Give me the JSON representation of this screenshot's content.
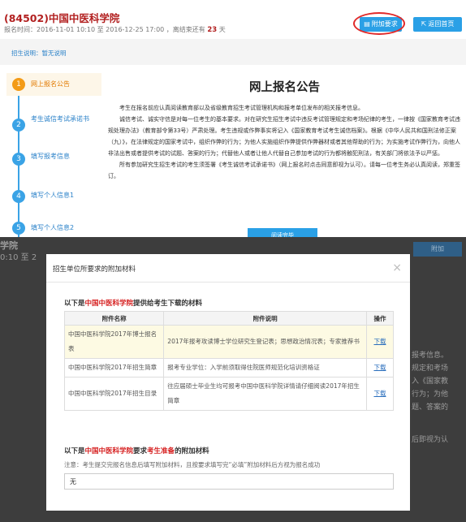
{
  "header": {
    "code": "(84502)",
    "school": "中国中医科学院",
    "meta_prefix": "报名时间：2016-11-01 10:10 至 2016-12-25 17:00 ，离结束还有 ",
    "days": "23",
    "meta_suffix": " 天",
    "btn_requirements": "附加要求",
    "btn_home": "返回首页"
  },
  "subbar": {
    "note": "招生说明：暂无说明"
  },
  "steps": [
    {
      "num": "1",
      "label": "网上报名公告"
    },
    {
      "num": "2",
      "label": "考生诚信考试承诺书"
    },
    {
      "num": "3",
      "label": "填写报考信息"
    },
    {
      "num": "4",
      "label": "填写个人信息1"
    },
    {
      "num": "5",
      "label": "填写个人信息2"
    }
  ],
  "notice": {
    "title": "网上报名公告",
    "p1": "考生在报名前应认真阅读教育部以及省级教育招生考试管理机构和报考单位发布的相关报考信息。",
    "p2": "诚信考试、诚实守信是对每一位考生的基本要求。对在研究生招生考试中违反考试管理规定和考场纪律的考生，一律按《国家教育考试违规处理办法》（教育部令第33号）严肃处理。考生违规或作弊事实将记入《国家教育考试考生诚信档案》。根据《中华人民共和国刑法修正案（九）》，在法律规定的国家考试中，组织作弊的行为；为他人实施组织作弊提供作弊器材或者其他帮助的行为；为实施考试作弊行为，向他人非法出售或者提供考试的试题、答案的行为；代替他人或者让他人代替自己参加考试的行为都将触犯刑法，有关部门将依法予以严惩。",
    "p3": "所有参加研究生招生考试的考生须签署《考生诚信考试承诺书》（网上报名时点击同意即视为认可）。请每一位考生务必认真阅读，郑重签订。",
    "btn_read": "阅读完毕"
  },
  "background_ghost": {
    "left_title": "学院",
    "left_time": "0:10 至 2",
    "btn": "附加",
    "lines": [
      "报考信息。",
      "规定和考场",
      "入《国家教",
      "行为；为他",
      "题、答案的",
      "后即视为认"
    ]
  },
  "modal": {
    "title": "招生单位所要求的附加材料",
    "close": "×",
    "section1_prefix": "以下是",
    "section1_school": "中国中医科学院",
    "section1_suffix": "提供给考生下载的材料",
    "table_headers": [
      "附件名称",
      "附件说明",
      "操作"
    ],
    "rows": [
      {
        "name": "中国中医科学院2017年博士报名表",
        "desc": "2017年报考攻读博士学位研究生登记表；思想政治情况表；专家推荐书",
        "action": "下载"
      },
      {
        "name": "中国中医科学院2017年招生简章",
        "desc": "报考专业学位：入学前须取得住院医师规范化培训资格证",
        "action": "下载"
      },
      {
        "name": "中国中医科学院2017年招生目录",
        "desc": "往应届硕士毕业生均可报考中国中医科学院详情请仔细阅读2017年招生简章",
        "action": "下载"
      }
    ],
    "section2_prefix": "以下是",
    "section2_school": "中国中医科学院",
    "section2_mid": "要求",
    "section2_red": "考生准备",
    "section2_suffix": "的附加材料",
    "note": "注意：考生提交完报名信息后填写附加材料，且按要求填写完“必填”附加材料后方视为报名成功",
    "textarea_value": "无"
  }
}
